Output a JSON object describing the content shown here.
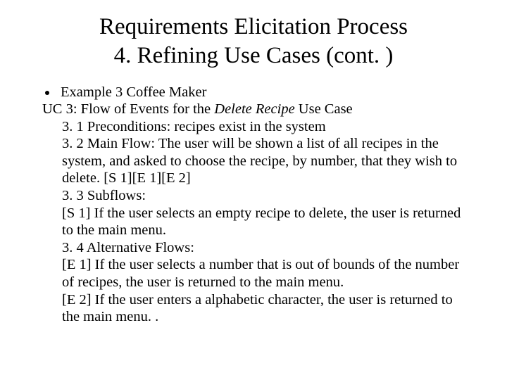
{
  "title_line1": "Requirements Elicitation Process",
  "title_line2": "4. Refining Use Cases (cont. )",
  "bullet1": "Example 3 Coffee Maker",
  "uc_prefix": "UC 3: Flow of Events for the ",
  "uc_italic": "Delete Recipe",
  "uc_suffix": " Use Case",
  "line_3_1": "3. 1 Preconditions: recipes exist in the system",
  "line_3_2": "3. 2 Main Flow: The user will be shown a list of all recipes in the system, and asked to choose the recipe, by number, that they wish to delete. [S 1][E 1][E 2]",
  "line_3_3": "3. 3 Subflows:",
  "line_s1": "[S 1] If the user selects an empty recipe to delete, the user is returned to the main menu.",
  "line_3_4": "3. 4 Alternative Flows:",
  "line_e1": "[E 1] If the user selects a number that is out of bounds of the number of recipes, the user is returned to the main menu.",
  "line_e2": "[E 2] If the user enters a alphabetic character, the user is returned to the main menu. ."
}
